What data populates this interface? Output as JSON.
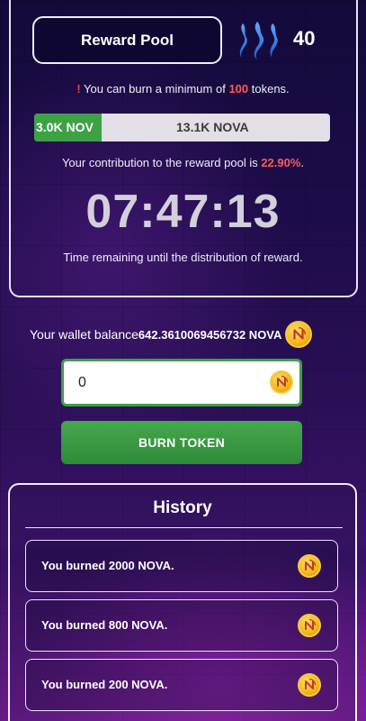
{
  "reward_pool": {
    "button_label": "Reward Pool",
    "steem_count": "40",
    "min_notice_prefix": "!",
    "min_notice_text_1": " You can burn a minimum of ",
    "min_amount": "100",
    "min_notice_text_2": " tokens.",
    "progress": {
      "user_label": "3.0K NOV",
      "pool_label": "13.1K NOVA",
      "fill_fraction": 0.229
    },
    "contribution_text": "Your contribution to the reward pool is ",
    "contribution_pct": "22.90%",
    "contribution_suffix": ".",
    "timer": "07:47:13",
    "timer_note": "Time remaining until the distribution of reward."
  },
  "wallet": {
    "label": "Your wallet balance",
    "balance": "642.3610069456732 NOVA",
    "icon": "nova-coin-icon"
  },
  "burn_form": {
    "input_value": "0",
    "button_label": "BURN TOKEN"
  },
  "history": {
    "title": "History",
    "items": [
      {
        "text": "You burned 2000 NOVA."
      },
      {
        "text": "You burned 800 NOVA."
      },
      {
        "text": "You burned 200 NOVA."
      }
    ]
  },
  "colors": {
    "accent_green": "#3ea245",
    "alert_red": "#ff5a5a",
    "panel_border": "#e9e4f5"
  }
}
